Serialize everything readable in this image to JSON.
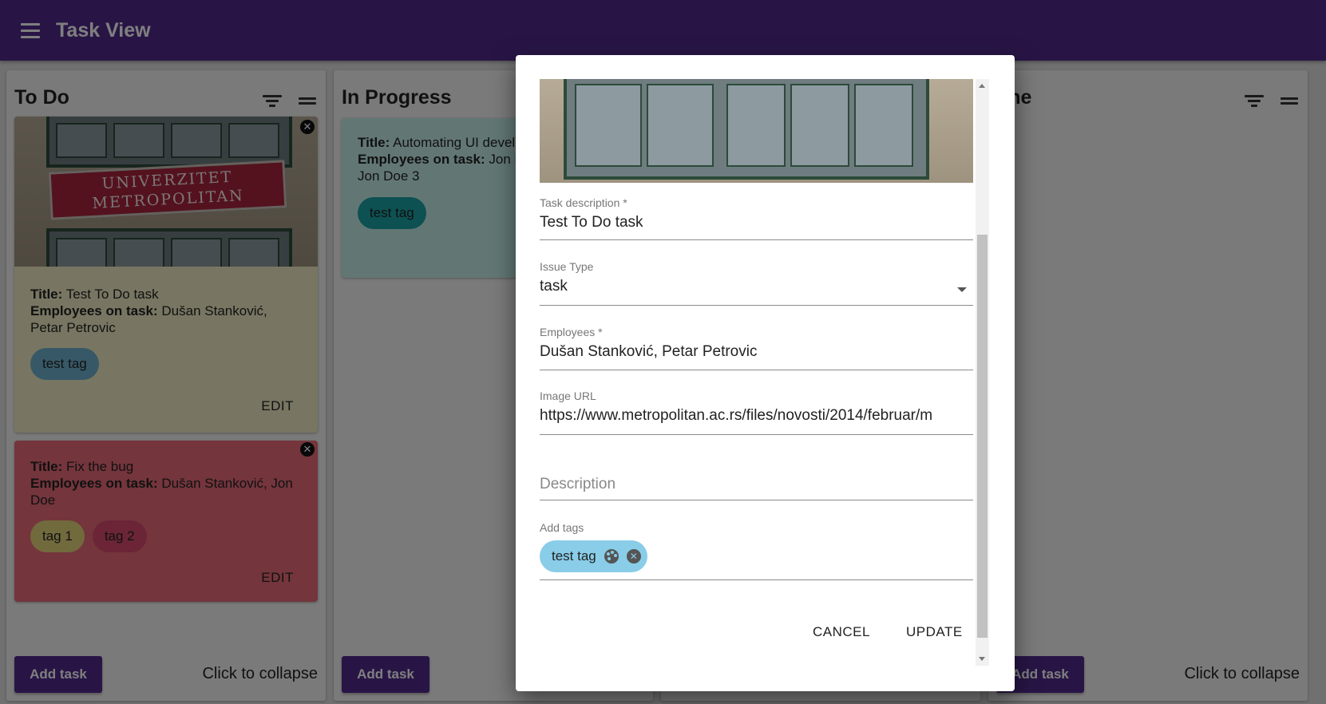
{
  "app": {
    "title": "Task View"
  },
  "columns": [
    {
      "title": "To Do",
      "add_label": "Add task",
      "collapse_label": "Click to collapse"
    },
    {
      "title": "In Progress",
      "add_label": "Add task"
    },
    {
      "title": ""
    },
    {
      "title": "one",
      "add_label": "Add task",
      "collapse_label": "Click to collapse"
    }
  ],
  "cards": {
    "todo_1": {
      "image_sign_line1": "UNIVERZITET",
      "image_sign_line2": "METROPOLITAN",
      "title_label": "Title:",
      "title": "Test To Do task",
      "employees_label": "Employees on task:",
      "employees": "Dušan Stanković, Petar Petrovic",
      "tags": [
        "test tag"
      ],
      "edit_label": "EDIT",
      "close": "✕",
      "color": "#f0ecc4"
    },
    "todo_2": {
      "title_label": "Title:",
      "title": "Fix the bug",
      "employees_label": "Employees on task:",
      "employees": "Dušan Stanković, Jon Doe",
      "tags": [
        "tag 1",
        "tag 2"
      ],
      "edit_label": "EDIT",
      "close": "✕",
      "color": "#e86a78"
    },
    "progress_1": {
      "title_label": "Title:",
      "title": "Automating UI devel",
      "employees_label": "Employees on task:",
      "employees": "Jon D",
      "employees_line2": "Jon Doe 3",
      "tags": [
        "test tag"
      ],
      "color": "#c4eee9"
    }
  },
  "tag_colors": {
    "test_tag": "#6fb0cf",
    "tag_1": "#e2d57a",
    "tag_2": "#d64a6e",
    "teal": "#1aa3a5"
  },
  "dialog": {
    "task_description_label": "Task description *",
    "task_description_value": "Test To Do task",
    "issue_type_label": "Issue Type",
    "issue_type_value": "task",
    "employees_label": "Employees *",
    "employees_value": "Dušan Stanković, Petar Petrovic",
    "image_url_label": "Image URL",
    "image_url_value": "https://www.metropolitan.ac.rs/files/novosti/2014/februar/m",
    "description_placeholder": "Description",
    "add_tags_label": "Add tags",
    "tag_chip": "test tag",
    "tag_delete": "✕",
    "cancel_label": "CANCEL",
    "update_label": "UPDATE"
  },
  "colors": {
    "appbar": "#512a8c",
    "primary": "#512a8c"
  }
}
